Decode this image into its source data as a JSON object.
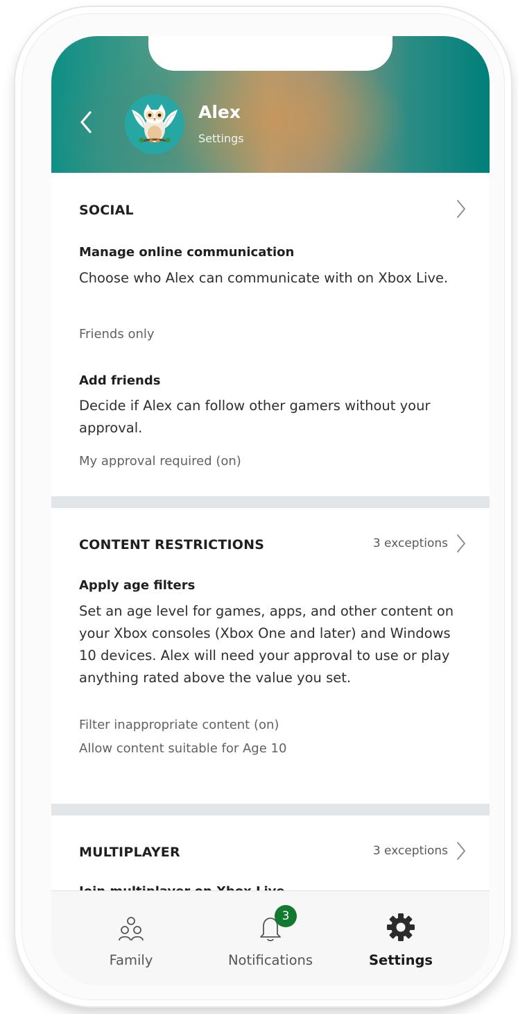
{
  "header": {
    "name": "Alex",
    "subtitle": "Settings"
  },
  "sections": {
    "social": {
      "title": "SOCIAL",
      "items": [
        {
          "title": "Manage online communication",
          "description": "Choose who Alex can communicate with on Xbox Live.",
          "value": "Friends only"
        },
        {
          "title": "Add friends",
          "description": "Decide if Alex can follow other gamers without your approval.",
          "value": "My approval required (on)"
        }
      ]
    },
    "content_restrictions": {
      "title": "CONTENT RESTRICTIONS",
      "exceptions": "3 exceptions",
      "items": [
        {
          "title": "Apply age filters",
          "description": "Set an age level for games, apps, and other content on your Xbox consoles (Xbox One and later) and Windows 10 devices. Alex will need your approval to use or play anything rated above the value you set.",
          "values": [
            "Filter inappropriate content (on)",
            "Allow content suitable for Age 10"
          ]
        }
      ]
    },
    "multiplayer": {
      "title": "MULTIPLAYER",
      "exceptions": "3 exceptions",
      "items": [
        {
          "title": "Join multiplayer on Xbox Live"
        }
      ]
    }
  },
  "tabs": {
    "family": {
      "label": "Family",
      "icon": "family-icon"
    },
    "notifications": {
      "label": "Notifications",
      "icon": "bell-icon",
      "badge": "3"
    },
    "settings": {
      "label": "Settings",
      "icon": "gear-icon",
      "active": true
    }
  },
  "colors": {
    "accent_teal": "#0e8f86",
    "badge_green": "#117a2e",
    "divider": "#e3e6e8"
  }
}
